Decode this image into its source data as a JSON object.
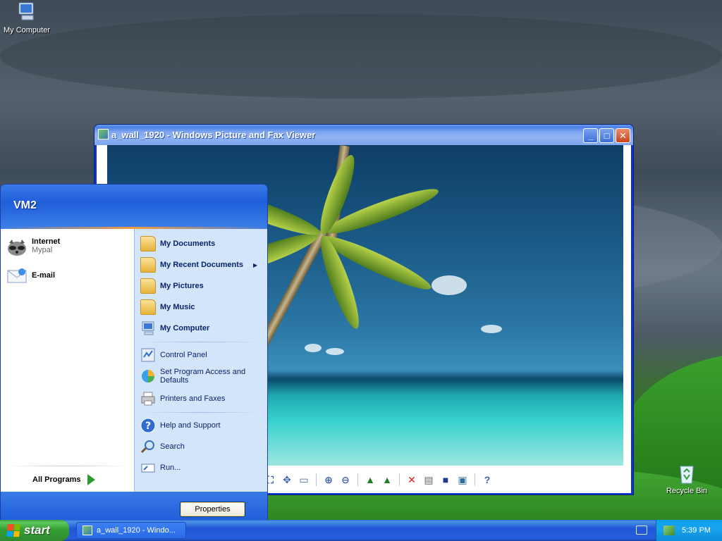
{
  "desktop": {
    "icons": [
      {
        "label": "My Computer"
      },
      {
        "label": "Recycle Bin"
      }
    ]
  },
  "viewer": {
    "title": "a_wall_1920 - Windows Picture and Fax Viewer",
    "controls": {
      "minimize": "_",
      "maximize": "□",
      "close": "✕"
    },
    "toolbar": [
      "fit-icon",
      "actual-size-icon",
      "slideshow-icon",
      "zoom-in-icon",
      "zoom-out-icon",
      "rotate-cw-icon",
      "rotate-ccw-icon",
      "delete-icon",
      "print-icon",
      "save-icon",
      "edit-icon",
      "help-icon"
    ]
  },
  "startmenu": {
    "user": "VM2",
    "pinned": [
      {
        "label": "Internet",
        "sub": "Mypal"
      },
      {
        "label": "E-mail",
        "sub": ""
      }
    ],
    "all_programs": "All Programs",
    "places": [
      {
        "label": "My Documents"
      },
      {
        "label": "My Recent Documents"
      },
      {
        "label": "My Pictures"
      },
      {
        "label": "My Music"
      },
      {
        "label": "My Computer"
      }
    ],
    "settings": [
      {
        "label": "Control Panel"
      },
      {
        "label": "Set Program Access and Defaults"
      },
      {
        "label": "Printers and Faxes"
      }
    ],
    "help": [
      {
        "label": "Help and Support"
      },
      {
        "label": "Search"
      },
      {
        "label": "Run..."
      }
    ],
    "properties_button": "Properties"
  },
  "taskbar": {
    "start_label": "start",
    "task_label": "a_wall_1920 - Windo...",
    "clock": "5:39 PM"
  },
  "colors": {
    "accent": "#245edb",
    "start_green": "#35a035",
    "tray_blue": "#0c9eec"
  }
}
